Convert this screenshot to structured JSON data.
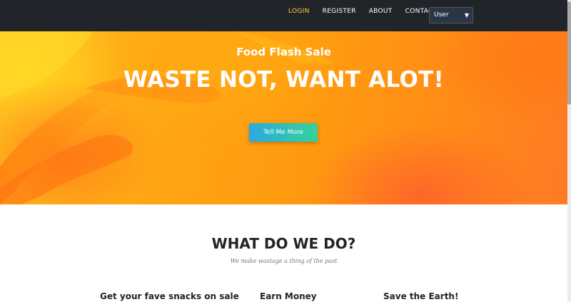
{
  "nav": {
    "links": [
      {
        "label": "LOGIN",
        "active": true
      },
      {
        "label": "REGISTER",
        "active": false
      },
      {
        "label": "ABOUT",
        "active": false
      },
      {
        "label": "CONTACT",
        "active": false
      }
    ],
    "role_select": {
      "selected": "User"
    }
  },
  "hero": {
    "subtitle": "Food Flash Sale",
    "title": "WASTE NOT, WANT ALOT!",
    "button_label": "Tell Me More"
  },
  "services": {
    "heading": "WHAT DO WE DO?",
    "subheading": "We make wastage a thing of the past",
    "features": [
      {
        "title": "Get your fave snacks on sale"
      },
      {
        "title": "Earn Money"
      },
      {
        "title": "Save the Earth!"
      }
    ]
  },
  "colors": {
    "navbar_bg": "#212529",
    "active_link": "#fed136",
    "button_gradient_start": "#2ba9e0",
    "button_gradient_end": "#36d19a",
    "hero_orange": "#ff9a10"
  }
}
